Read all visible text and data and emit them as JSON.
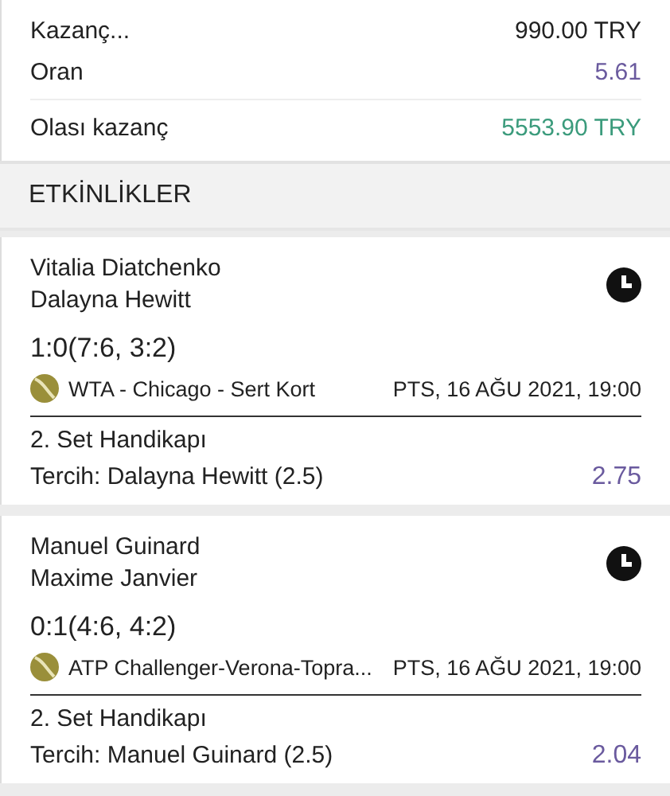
{
  "summary": [
    {
      "label": "Kazanç...",
      "value": "990.00 TRY",
      "kind": "plain"
    },
    {
      "label": "Oran",
      "value": "5.61",
      "kind": "odds"
    },
    {
      "label": "Olası kazanç",
      "value": "5553.90 TRY",
      "kind": "win"
    }
  ],
  "section_title": "ETKİNLİKLER",
  "events": [
    {
      "players": [
        "Vitalia Diatchenko",
        "Dalayna Hewitt"
      ],
      "score": "1:0(7:6, 3:2)",
      "league": "WTA - Chicago - Sert Kort",
      "datetime": "PTS, 16 AĞU 2021, 19:00",
      "market": "2. Set Handikapı",
      "pick": "Tercih: Dalayna Hewitt (2.5)",
      "odds": "2.75"
    },
    {
      "players": [
        "Manuel Guinard",
        "Maxime Janvier"
      ],
      "score": "0:1(4:6, 4:2)",
      "league": "ATP Challenger-Verona-Topra...",
      "datetime": "PTS, 16 AĞU 2021, 19:00",
      "market": "2. Set Handikapı",
      "pick": "Tercih: Manuel Guinard (2.5)",
      "odds": "2.04"
    }
  ]
}
